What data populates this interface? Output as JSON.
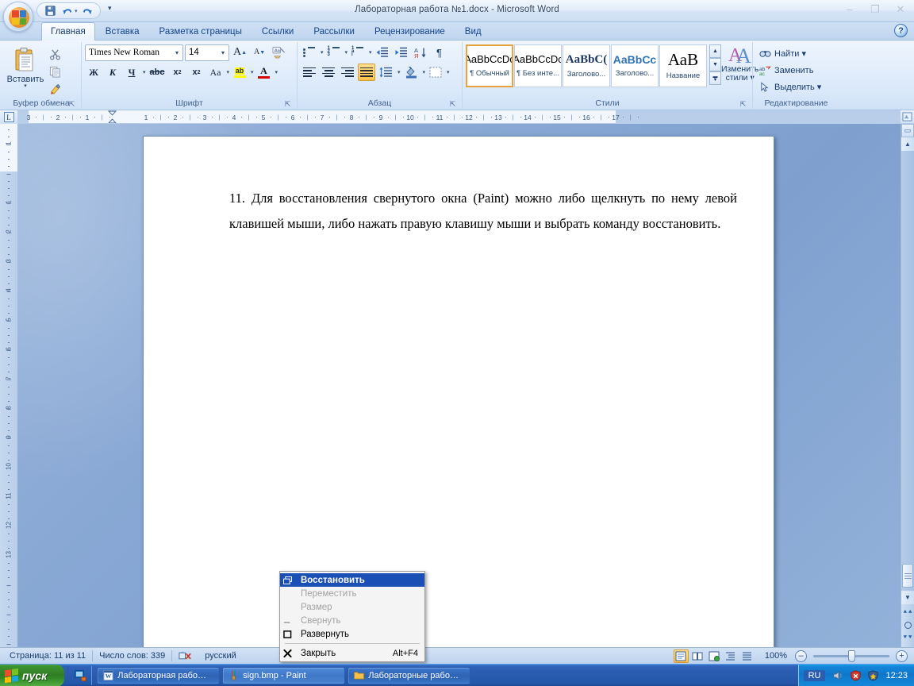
{
  "window": {
    "title": "Лабораторная работа №1.docx - Microsoft Word",
    "minimize_label": "–",
    "restore_label": "❐",
    "close_label": "✕",
    "help_label": "?"
  },
  "quick_access": {
    "save_label": "💾",
    "undo_label": "↰",
    "undo_caret": "▾",
    "redo_label": "↻",
    "customize_label": "▾"
  },
  "tabs": [
    {
      "label": "Главная",
      "active": true
    },
    {
      "label": "Вставка",
      "active": false
    },
    {
      "label": "Разметка страницы",
      "active": false
    },
    {
      "label": "Ссылки",
      "active": false
    },
    {
      "label": "Рассылки",
      "active": false
    },
    {
      "label": "Рецензирование",
      "active": false
    },
    {
      "label": "Вид",
      "active": false
    }
  ],
  "ribbon": {
    "groups": {
      "clipboard": {
        "label": "Буфер обмена",
        "paste_label": "Вставить",
        "paste_caret": "▾",
        "cut_label": "✂",
        "copy_label": "⧉",
        "format_painter_label": "🖌",
        "launcher": "⇱"
      },
      "font": {
        "label": "Шрифт",
        "font_name": "Times New Roman",
        "font_size": "14",
        "grow_font": "A",
        "shrink_font": "A",
        "clear_format": "Aa",
        "bold": "Ж",
        "italic": "К",
        "underline": "Ч",
        "strikethrough": "abc",
        "subscript": "x₂",
        "superscript": "x²",
        "change_case": "Aa",
        "highlight": "ab",
        "font_color": "A",
        "launcher": "⇱"
      },
      "paragraph": {
        "label": "Абзац",
        "bullets": "bullets",
        "numbering": "numbering",
        "multilevel": "multilevel",
        "decrease_indent": "◀≡",
        "increase_indent": "≡▶",
        "sort": "А↓",
        "show_marks": "¶",
        "align_left": "align-left",
        "align_center": "align-center",
        "align_right": "align-right",
        "align_justify": "align-justify",
        "line_spacing": "↕≡",
        "shading": "shading",
        "borders": "borders",
        "launcher": "⇱"
      },
      "styles": {
        "label": "Стили",
        "items": [
          {
            "sample": "AaBbCcDc",
            "name": "¶ Обычный",
            "selected": true,
            "serif": false,
            "color": "#000000",
            "bold": false
          },
          {
            "sample": "AaBbCcDc",
            "name": "¶ Без инте...",
            "selected": false,
            "serif": false,
            "color": "#000000",
            "bold": false
          },
          {
            "sample": "AaBbC(",
            "name": "Заголово...",
            "selected": false,
            "serif": true,
            "color": "#1f3864",
            "bold": true
          },
          {
            "sample": "AaBbCc",
            "name": "Заголово...",
            "selected": false,
            "serif": false,
            "color": "#2e74b5",
            "bold": true
          },
          {
            "sample": "АаВ",
            "name": "Название",
            "selected": false,
            "serif": true,
            "color": "#000000",
            "bold": false
          }
        ],
        "scroll_up": "▲",
        "scroll_down": "▼",
        "more": "▼",
        "change_styles_line1": "Изменить",
        "change_styles_line2": "стили ▾",
        "launcher": "⇱"
      },
      "editing": {
        "label": "Редактирование",
        "find_label": "Найти ▾",
        "replace_label": "Заменить",
        "select_label": "Выделить ▾"
      }
    }
  },
  "ruler": {
    "tabstop_marker": "L",
    "h_labels": [
      "3",
      "2",
      "1",
      "1",
      "2",
      "3",
      "4",
      "5",
      "6",
      "7",
      "8",
      "9",
      "10",
      "11",
      "12",
      "13",
      "14",
      "15",
      "16",
      "17"
    ],
    "v_labels": [
      "1",
      "1",
      "2",
      "3",
      "4",
      "5",
      "6",
      "7",
      "8",
      "9",
      "10",
      "11",
      "12",
      "13",
      "14"
    ]
  },
  "document": {
    "paragraphs": [
      "11. Для восстановления свернутого окна (Paint) можно либо щелкнуть по нему левой клавишей мыши, либо нажать правую клавишу мыши и выбрать команду восстановить."
    ]
  },
  "context_menu": {
    "items": [
      {
        "icon": "restore-glyph",
        "label": "Восстановить",
        "accel": "",
        "state": "selected"
      },
      {
        "icon": "",
        "label": "Переместить",
        "accel": "",
        "state": "disabled"
      },
      {
        "icon": "",
        "label": "Размер",
        "accel": "",
        "state": "disabled"
      },
      {
        "icon": "minimize-glyph",
        "label": "Свернуть",
        "accel": "",
        "state": "disabled"
      },
      {
        "icon": "maximize-glyph",
        "label": "Развернуть",
        "accel": "",
        "state": "normal"
      },
      {
        "separator": true
      },
      {
        "icon": "close-glyph",
        "label": "Закрыть",
        "accel": "Alt+F4",
        "state": "normal"
      }
    ]
  },
  "status_bar": {
    "page_label": "Страница: 11 из 11",
    "words_label": "Число слов: 339",
    "language_label": "русский",
    "proofing_icon": "spellcheck-icon",
    "views": [
      {
        "name": "print-layout",
        "glyph": "▤",
        "active": true
      },
      {
        "name": "full-screen-reading",
        "glyph": "▥",
        "active": false
      },
      {
        "name": "web-layout",
        "glyph": "▦",
        "active": false
      },
      {
        "name": "outline",
        "glyph": "▤",
        "active": false
      },
      {
        "name": "draft",
        "glyph": "▤",
        "active": false
      }
    ],
    "zoom_label": "100%",
    "zoom_out": "–",
    "zoom_in": "+"
  },
  "taskbar": {
    "start_label": "пуск",
    "quick_launch": [
      {
        "name": "show-desktop-icon",
        "glyph": "🗗"
      }
    ],
    "tasks": [
      {
        "icon": "word-icon",
        "label": "Лабораторная рабо…",
        "active": false
      },
      {
        "icon": "paint-icon",
        "label": "sign.bmp - Paint",
        "active": true
      },
      {
        "icon": "folder-icon",
        "label": "Лабораторные рабо…",
        "active": false
      }
    ],
    "tray": {
      "language": "RU",
      "icons": [
        {
          "name": "volume-icon",
          "glyph": "🔊"
        },
        {
          "name": "security-shield-icon",
          "glyph": "🛡"
        },
        {
          "name": "antivirus-icon",
          "glyph": "🛡"
        }
      ],
      "clock": "12:23"
    }
  },
  "colors": {
    "accent_blue": "#1a4fb5",
    "ribbon_bg": "#dceafa",
    "taskbar_blue": "#2a5cb0",
    "start_green": "#3d9130",
    "highlight_orange": "#ffc24d"
  }
}
